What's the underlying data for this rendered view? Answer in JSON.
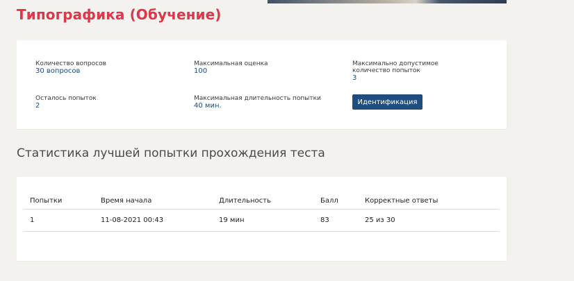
{
  "page_title": "Типографика (Обучение)",
  "info": {
    "questions_label": "Количество вопросов",
    "questions_value": "30 вопросов",
    "max_score_label": "Максимальная оценка",
    "max_score_value": "100",
    "max_attempts_label": "Максимально допустимое количество попыток",
    "max_attempts_value": "3",
    "attempts_left_label": "Осталось попыток",
    "attempts_left_value": "2",
    "max_duration_label": "Максимальная длительность попытки",
    "max_duration_value": "40 мин.",
    "identify_button": "Идентификация"
  },
  "stats_heading": "Статистика лучшей попытки прохождения теста",
  "stats_table": {
    "headers": [
      "Попытки",
      "Время начала",
      "Длительность",
      "Балл",
      "Корректные ответы"
    ],
    "rows": [
      [
        "1",
        "11-08-2021 00:43",
        "19 мин",
        "83",
        "25 из 30"
      ]
    ]
  },
  "colors": {
    "title": "#e0364a",
    "accent": "#1d4e7d",
    "background": "#f3f2ef"
  }
}
